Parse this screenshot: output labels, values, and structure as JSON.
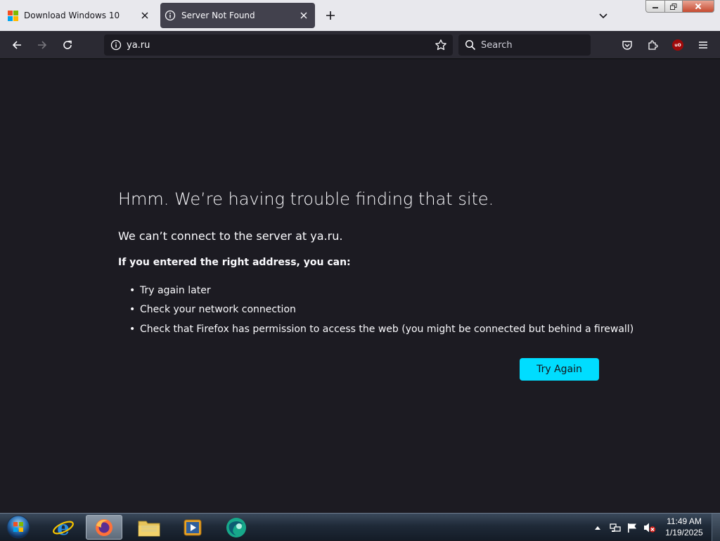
{
  "tabs": [
    {
      "label": "Download Windows 10",
      "active": false,
      "icon": "microsoft-logo-icon"
    },
    {
      "label": "Server Not Found",
      "active": true,
      "icon": "info-icon"
    }
  ],
  "url": "ya.ru",
  "search": {
    "placeholder": "Search"
  },
  "error": {
    "title": "Hmm. We’re having trouble finding that site.",
    "description": "We can’t connect to the server at ya.ru.",
    "subtitle": "If you entered the right address, you can:",
    "suggestions": [
      "Try again later",
      "Check your network connection",
      "Check that Firefox has permission to access the web (you might be connected but behind a firewall)"
    ],
    "button_label": "Try Again"
  },
  "extensions": {
    "ublock_badge": "uO"
  },
  "taskbar": {
    "clock_time": "11:49 AM",
    "clock_date": "1/19/2025"
  },
  "colors": {
    "accent": "#00ddff",
    "content_bg": "#1c1b22",
    "toolbar_bg": "#2b2a33",
    "active_tab_bg": "#42414d"
  }
}
